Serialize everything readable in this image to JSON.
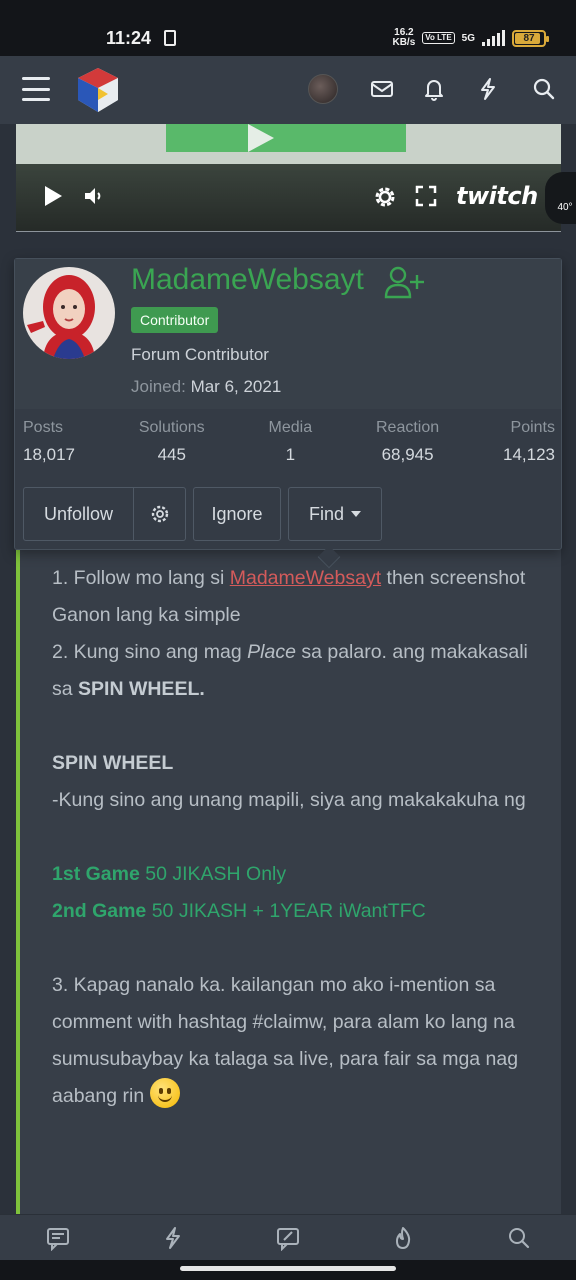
{
  "status_bar": {
    "time": "11:24",
    "net_speed_value": "16.2",
    "net_speed_unit": "KB/s",
    "volte": "Vo LTE",
    "network": "5G",
    "battery": "87"
  },
  "header": {
    "menu_icon": "hamburger-menu-icon",
    "logo": "site-logo",
    "icons": [
      "avatar",
      "envelope-icon",
      "bell-icon",
      "bolt-icon",
      "search-icon"
    ]
  },
  "video": {
    "brand": "twitch",
    "speed_badge": "40°"
  },
  "profile": {
    "username": "MadameWebsayt",
    "badge": "Contributor",
    "user_title": "Forum Contributor",
    "joined_label": "Joined:",
    "joined_value": "Mar 6, 2021",
    "stats": [
      {
        "label": "Posts",
        "value": "18,017"
      },
      {
        "label": "Solutions",
        "value": "445"
      },
      {
        "label": "Media",
        "value": "1"
      },
      {
        "label": "Reaction",
        "value": "68,945"
      },
      {
        "label": "Points",
        "value": "14,123"
      }
    ],
    "actions": {
      "unfollow": "Unfollow",
      "ignore": "Ignore",
      "find": "Find"
    }
  },
  "post": {
    "line1_a": "1. Follow mo lang si ",
    "line1_mention": "MadameWebsayt",
    "line1_b": " then screenshot Ganon lang ka simple",
    "line2_a": "2. Kung sino ang mag ",
    "line2_em": "Place",
    "line2_b": " sa palaro. ang makakasali sa ",
    "line2_strong": "SPIN WHEEL.",
    "heading": "SPIN WHEEL",
    "spin_text": "-Kung sino ang unang mapili, siya ang makakakuha ng",
    "game1_label": "1st Game",
    "game1_text": " 50 JIKASH Only",
    "game2_label": "2nd Game",
    "game2_text": " 50 JIKASH + 1YEAR iWantTFC",
    "line3": "3. Kapag nanalo ka. kailangan mo ako i-mention sa comment with hashtag #claimw, para alam ko lang na sumusubaybay ka talaga sa live, para fair sa mga nag aabang rin "
  },
  "bottom_nav": [
    "comment-icon",
    "bolt-icon",
    "edit-icon",
    "fire-icon",
    "search-icon"
  ]
}
